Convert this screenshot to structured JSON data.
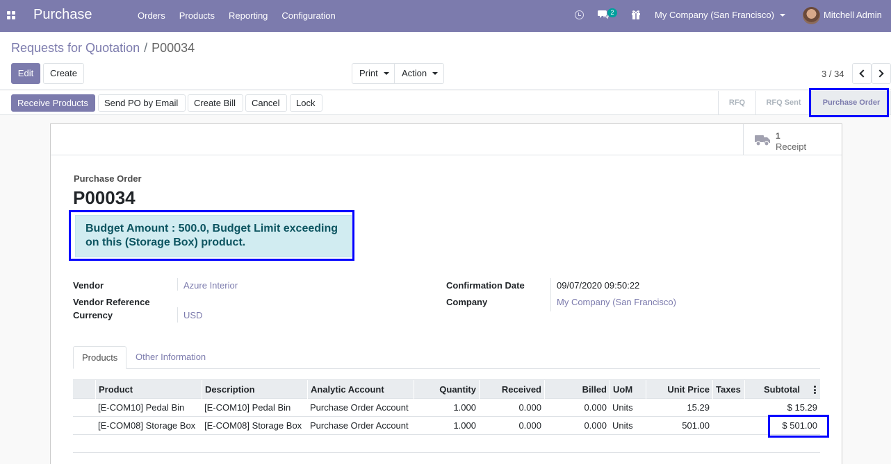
{
  "navbar": {
    "app_name": "Purchase",
    "menu": [
      "Orders",
      "Products",
      "Reporting",
      "Configuration"
    ],
    "chat_count": "2",
    "company": "My Company (San Francisco)",
    "user": "Mitchell Admin",
    "color": "#7c7bad"
  },
  "breadcrumb": {
    "parent": "Requests for Quotation",
    "separator": "/",
    "current": "P00034"
  },
  "toolbar": {
    "edit": "Edit",
    "create": "Create",
    "print": "Print",
    "action": "Action",
    "pager": "3 / 34"
  },
  "statusbar": {
    "buttons": [
      "Receive Products",
      "Send PO by Email",
      "Create Bill",
      "Cancel",
      "Lock"
    ],
    "stages": [
      "RFQ",
      "RFQ Sent",
      "Purchase Order"
    ],
    "active_stage": "Purchase Order"
  },
  "receipt": {
    "count": "1",
    "label": "Receipt"
  },
  "order": {
    "doc_label": "Purchase Order",
    "name": "P00034",
    "alert": "Budget Amount : 500.0, Budget Limit exceeding on this (Storage Box) product."
  },
  "fields": {
    "vendor_label": "Vendor",
    "vendor": "Azure Interior",
    "vendor_ref_label": "Vendor Reference",
    "vendor_ref": "",
    "currency_label": "Currency",
    "currency": "USD",
    "confirmation_label": "Confirmation Date",
    "confirmation": "09/07/2020 09:50:22",
    "company_label": "Company",
    "company": "My Company (San Francisco)"
  },
  "tabs": [
    "Products",
    "Other Information"
  ],
  "table": {
    "columns": [
      "Product",
      "Description",
      "Analytic Account",
      "Quantity",
      "Received",
      "Billed",
      "UoM",
      "Unit Price",
      "Taxes",
      "Subtotal"
    ],
    "rows": [
      [
        "[E-COM10] Pedal Bin",
        "[E-COM10] Pedal Bin",
        "Purchase Order Account",
        "1.000",
        "0.000",
        "0.000",
        "Units",
        "15.29",
        "",
        "$ 15.29"
      ],
      [
        "[E-COM08] Storage Box",
        "[E-COM08] Storage Box",
        "Purchase Order Account",
        "1.000",
        "0.000",
        "0.000",
        "Units",
        "501.00",
        "",
        "$ 501.00"
      ]
    ]
  }
}
